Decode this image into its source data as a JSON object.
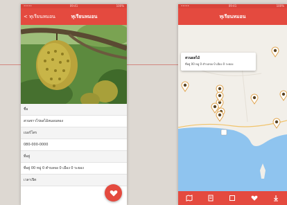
{
  "left_phone": {
    "status": {
      "carrier": "•••••",
      "time": "09:41",
      "battery": "100%"
    },
    "appbar": {
      "back_label": "< ทุเรียนหมอน",
      "title": "ทุเรียนหมอน"
    },
    "details": [
      {
        "kind": "label",
        "text": "ชื่อ"
      },
      {
        "kind": "value",
        "text": "สวนชาวไร่ผลไม้หมอนทอง"
      },
      {
        "kind": "label",
        "text": "เบอร์โทร"
      },
      {
        "kind": "value",
        "text": "080-000-0000"
      },
      {
        "kind": "label",
        "text": "ที่อยู่"
      },
      {
        "kind": "value",
        "text": "ที่อยู่ 00 หมู่ 0 ตำบลจอ 0 เมือง 0 ระยอง"
      },
      {
        "kind": "label",
        "text": "เวลาเปิด"
      }
    ]
  },
  "right_phone": {
    "status": {
      "carrier": "•••••",
      "time": "09:41",
      "battery": "100%"
    },
    "appbar": {
      "title": "ทุเรียนหมอน"
    },
    "popup": {
      "title": "สวนผลไม้",
      "subtitle": "ที่อยู่ 00 หมู่ 0 ตำบลจอ 0 เมือง 0 ระยอง"
    },
    "colors": {
      "accent": "#e44a3f",
      "pin": "#e0a24a",
      "sea": "#8fc4ef",
      "land": "#f2efe9"
    },
    "tabs": [
      "map-icon",
      "list-icon",
      "sort-icon",
      "heart-icon",
      "download-icon"
    ]
  }
}
